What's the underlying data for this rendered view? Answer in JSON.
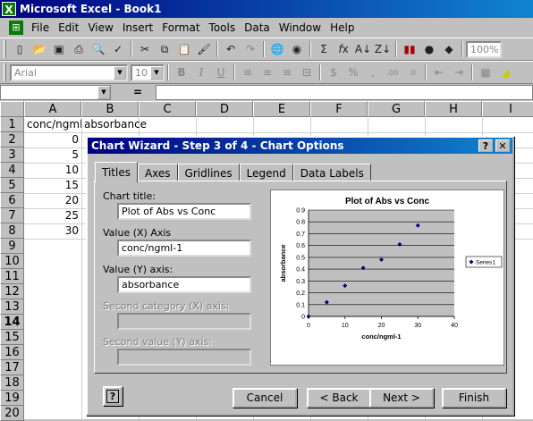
{
  "window": {
    "title": "Microsoft Excel - Book1"
  },
  "menu": [
    "File",
    "Edit",
    "View",
    "Insert",
    "Format",
    "Tools",
    "Data",
    "Window",
    "Help"
  ],
  "toolbar": {
    "zoom": "100%"
  },
  "format_toolbar": {
    "font": "Arial",
    "size": "10",
    "bold": "B",
    "italic": "I",
    "underline": "U"
  },
  "formula_bar": {
    "equals": "="
  },
  "columns": [
    "A",
    "B",
    "C",
    "D",
    "E",
    "F",
    "G",
    "H",
    "I"
  ],
  "rows": [
    "1",
    "2",
    "3",
    "4",
    "5",
    "6",
    "7",
    "8",
    "9",
    "10",
    "11",
    "12",
    "13",
    "14",
    "15",
    "16",
    "17",
    "18",
    "19",
    "20"
  ],
  "cells": {
    "A1": "conc/ngml-1",
    "B1": "absorbance",
    "A_values": [
      "0",
      "5",
      "10",
      "15",
      "20",
      "25",
      "30"
    ]
  },
  "dialog": {
    "title": "Chart Wizard - Step 3 of 4 - Chart Options",
    "help_btn": "?",
    "close_btn": "✕",
    "tabs": [
      "Titles",
      "Axes",
      "Gridlines",
      "Legend",
      "Data Labels"
    ],
    "chart_title_label": "Chart title:",
    "chart_title_value": "Plot of Abs vs Conc",
    "x_axis_label": "Value (X) Axis",
    "x_axis_value": "conc/ngml-1",
    "y_axis_label": "Value (Y) axis:",
    "y_axis_value": "absorbance",
    "second_x_label": "Second category (X) axis:",
    "second_y_label": "Second value (Y) axis:",
    "buttons": {
      "cancel": "Cancel",
      "back": "< Back",
      "next": "Next >",
      "finish": "Finish"
    }
  },
  "chart_data": {
    "type": "scatter",
    "title": "Plot of Abs vs Conc",
    "xlabel": "conc/ngml-1",
    "ylabel": "absorbance",
    "xlim": [
      0,
      40
    ],
    "ylim": [
      0,
      0.9
    ],
    "x_ticks": [
      "0",
      "10",
      "20",
      "30",
      "40"
    ],
    "y_ticks": [
      "0",
      "0.1",
      "0.2",
      "0.3",
      "0.4",
      "0.5",
      "0.6",
      "0.7",
      "0.8",
      "0.9"
    ],
    "grid": true,
    "legend": "right",
    "series": [
      {
        "name": "Series1",
        "x": [
          0,
          5,
          10,
          15,
          20,
          25,
          30
        ],
        "y": [
          0,
          0.12,
          0.26,
          0.41,
          0.48,
          0.61,
          0.77
        ]
      }
    ]
  }
}
